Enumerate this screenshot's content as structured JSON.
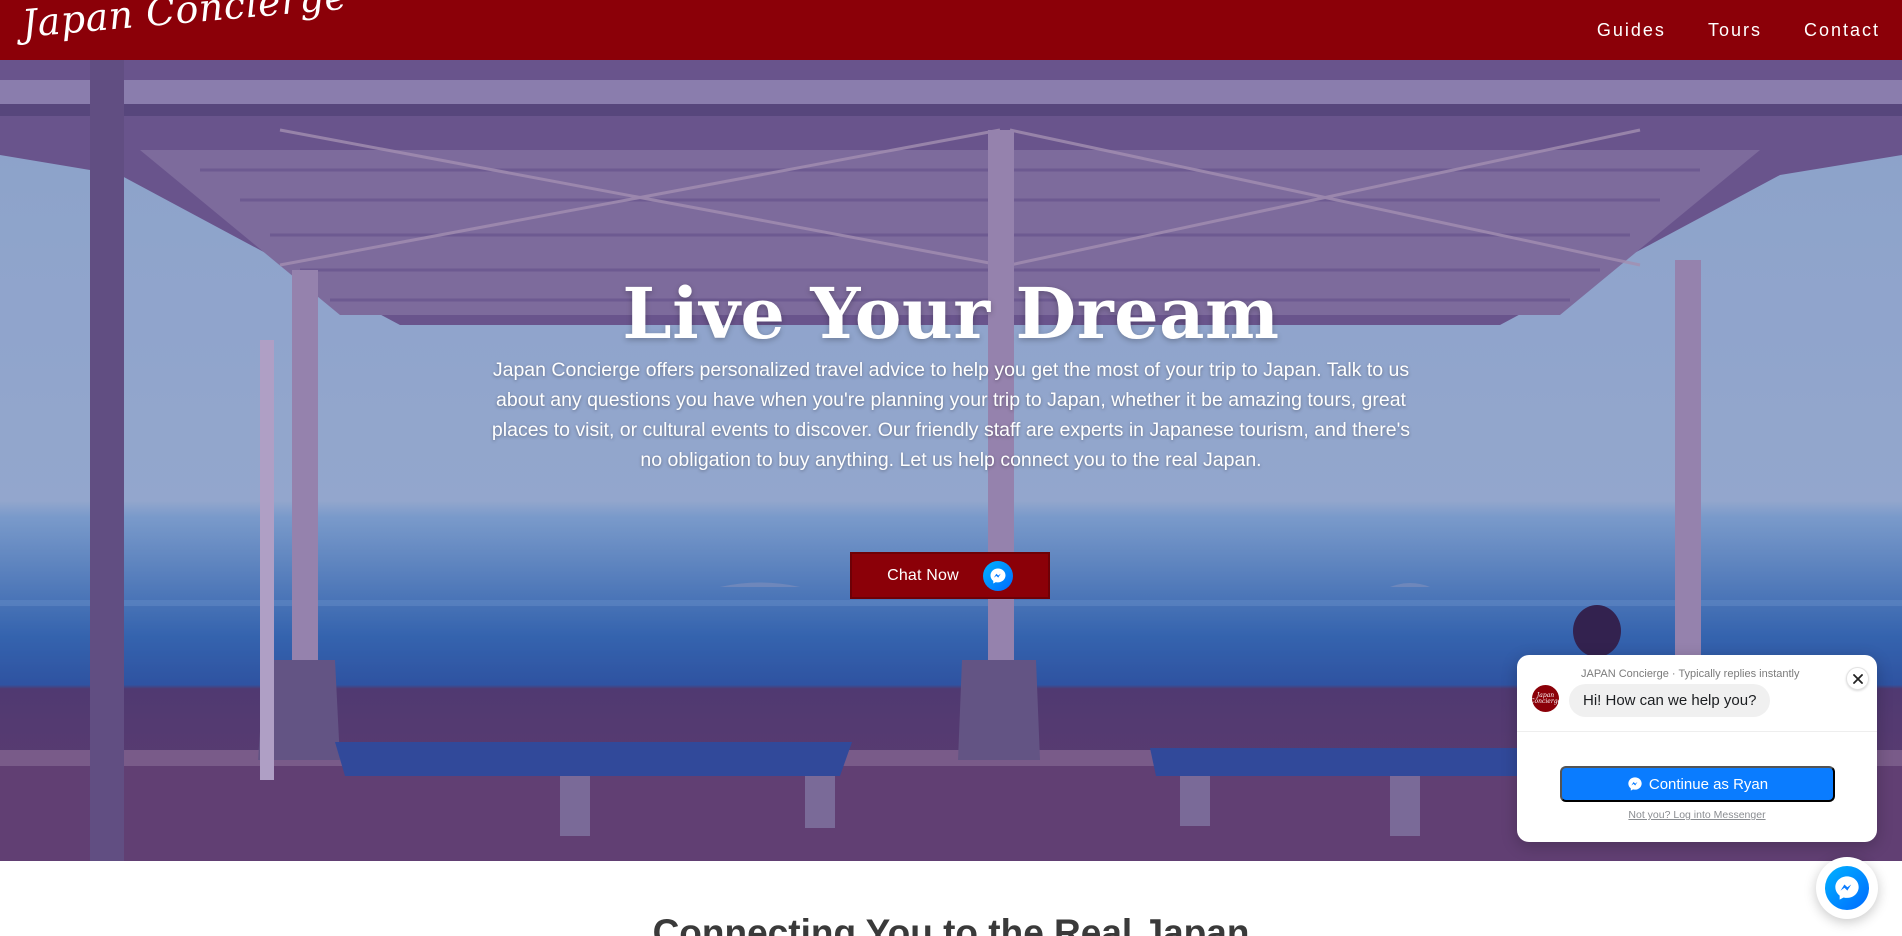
{
  "navbar": {
    "brand": "Japan Concierge",
    "links": [
      {
        "label": "Guides"
      },
      {
        "label": "Tours"
      },
      {
        "label": "Contact"
      }
    ],
    "background": "#8b0008"
  },
  "hero": {
    "title": "Live Your Dream",
    "description": "Japan Concierge offers personalized travel advice to help you get the most of your trip to Japan. Talk to us about any questions you have when you're planning your trip to Japan, whether it be amazing tours, great places to visit, or cultural events to discover. Our friendly staff are experts in Japanese tourism, and there's no obligation to buy anything. Let us help connect you to the real Japan.",
    "cta_label": "Chat Now",
    "cta_icon": "messenger-icon",
    "cta_color": "#8b0008"
  },
  "messenger_popup": {
    "avatar_text": "Japan Concierge",
    "page_name": "JAPAN Concierge",
    "reply_time": "Typically replies instantly",
    "greeting": "Hi! How can we help you?",
    "continue_label": "Continue as Ryan",
    "alt_login_label": "Not you? Log into Messenger",
    "button_color": "#0a7cff"
  },
  "section": {
    "heading": "Connecting You to the Real Japan"
  }
}
